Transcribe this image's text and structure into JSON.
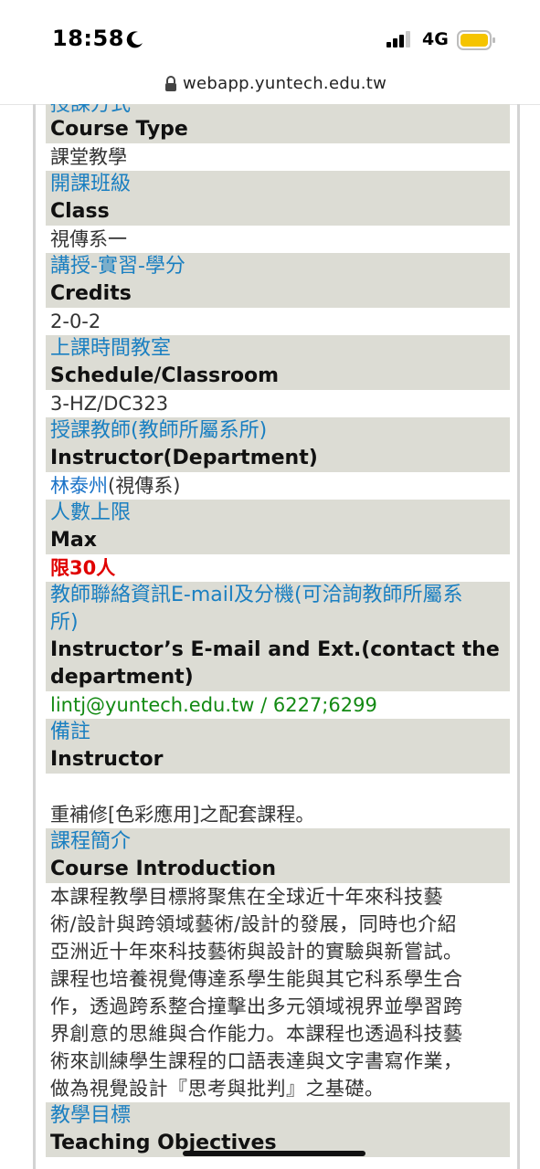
{
  "status_bar": {
    "time": "18:58",
    "network": "4G"
  },
  "browser": {
    "url": "webapp.yuntech.edu.tw"
  },
  "fields": [
    {
      "key": "course_type",
      "zh": "授課方式",
      "en": "Course Type",
      "value": "課堂教學"
    },
    {
      "key": "class",
      "zh": "開課班級",
      "en": "Class",
      "value": "視傳系一"
    },
    {
      "key": "credits",
      "zh": "講授-實習-學分",
      "en": "Credits",
      "value": "2-0-2"
    },
    {
      "key": "schedule",
      "zh": "上課時間教室",
      "en": "Schedule/Classroom",
      "value": "3-HZ/DC323"
    },
    {
      "key": "instructor",
      "zh": "授課教師(教師所屬系所)",
      "en": "Instructor(Department)",
      "value_link": "林泰州",
      "value_rest": "(視傳系)"
    },
    {
      "key": "max",
      "zh": "人數上限",
      "en": "Max",
      "value": "限30人"
    },
    {
      "key": "contact",
      "zh_line1": "教師聯絡資訊E-mail及分機(可洽詢教師所屬系",
      "zh_line2": "所)",
      "en_line1": "Instructor’s E-mail and Ext.(contact the",
      "en_line2": "department)",
      "value": "lintj@yuntech.edu.tw / 6227;6299"
    },
    {
      "key": "remarks",
      "zh": "備註",
      "en": "Instructor",
      "value": "重補修[色彩應用]之配套課程。"
    },
    {
      "key": "intro",
      "zh": "課程簡介",
      "en": "Course Introduction",
      "lines": [
        "本課程教學目標將聚焦在全球近十年來科技藝",
        "術/設計與跨領域藝術/設計的發展，同時也介紹",
        "亞洲近十年來科技藝術與設計的實驗與新嘗試。",
        "課程也培養視覺傳達系學生能與其它科系學生合",
        "作，透過跨系整合撞擊出多元領域視界並學習跨",
        "界創意的思維與合作能力。本課程也透過科技藝",
        "術來訓練學生課程的口語表達與文字書寫作業，",
        "做為視覺設計『思考與批判』之基礎。"
      ]
    },
    {
      "key": "objectives",
      "zh": "教學目標",
      "en": "Teaching Objectives"
    }
  ],
  "colors": {
    "label_blue": "#1a7fc1",
    "band_bg": "#dcdcd4",
    "red": "#e00000",
    "green": "#138a13"
  }
}
